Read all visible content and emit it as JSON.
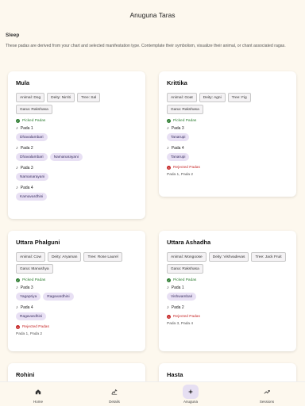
{
  "header": {
    "title": "Anuguna Taras"
  },
  "section": {
    "title": "Sleep",
    "description": "These padas are derived from your chart and selected manifestation type. Contemplate their symbolism, visualize their animal, or chant associated ragas."
  },
  "labels": {
    "picked": "Picked Padas",
    "rejected": "Rejected Padas"
  },
  "cards": [
    {
      "name": "Mula",
      "chips": [
        "Animal: Dog",
        "Deity: Nirriti",
        "Tree: Sal",
        "Gana: Rakshasa"
      ],
      "picked": [
        {
          "pada": "Pada 1",
          "ragas": [
            "Dhavalambari"
          ]
        },
        {
          "pada": "Pada 2",
          "ragas": [
            "Dhavalambari",
            "Namanarayani"
          ]
        },
        {
          "pada": "Pada 3",
          "ragas": [
            "Namanarayani"
          ]
        },
        {
          "pada": "Pada 4",
          "ragas": [
            "Kamavardhini"
          ]
        }
      ],
      "rejected": ""
    },
    {
      "name": "Krittika",
      "chips": [
        "Animal: Goat",
        "Deity: Agni",
        "Tree: Fig",
        "Gana: Rakshasa"
      ],
      "picked": [
        {
          "pada": "Pada 3",
          "ragas": [
            "Tanarupi"
          ]
        },
        {
          "pada": "Pada 4",
          "ragas": [
            "Tanarupi"
          ]
        }
      ],
      "rejected": "Pada 1, Pada 2"
    },
    {
      "name": "Uttara Phalguni",
      "chips": [
        "Animal: Cow",
        "Deity: Aryaman",
        "Tree: Rose Laurel",
        "Gana: Manushya"
      ],
      "picked": [
        {
          "pada": "Pada 3",
          "ragas": [
            "Yagapriya",
            "Ragavardhini"
          ]
        },
        {
          "pada": "Pada 4",
          "ragas": [
            "Ragavardhini"
          ]
        }
      ],
      "rejected": "Pada 1, Pada 2"
    },
    {
      "name": "Uttara Ashadha",
      "chips": [
        "Animal: Mongoose",
        "Deity: Vishvadevas",
        "Tree: Jack Fruit",
        "Gana: Rakshasa"
      ],
      "picked": [
        {
          "pada": "Pada 1",
          "ragas": [
            "Vishwambari"
          ]
        },
        {
          "pada": "Pada 2",
          "ragas": []
        }
      ],
      "rejected": "Pada 3, Pada 4"
    },
    {
      "name": "Rohini",
      "chips": [],
      "picked": [],
      "rejected": ""
    },
    {
      "name": "Hasta",
      "chips": [],
      "picked": [],
      "rejected": ""
    }
  ],
  "nav": [
    {
      "label": "Home",
      "icon": "home-icon"
    },
    {
      "label": "Details",
      "icon": "chart-icon"
    },
    {
      "label": "Anuguna",
      "icon": "sparkle-icon"
    },
    {
      "label": "Sessions",
      "icon": "trend-icon"
    }
  ]
}
